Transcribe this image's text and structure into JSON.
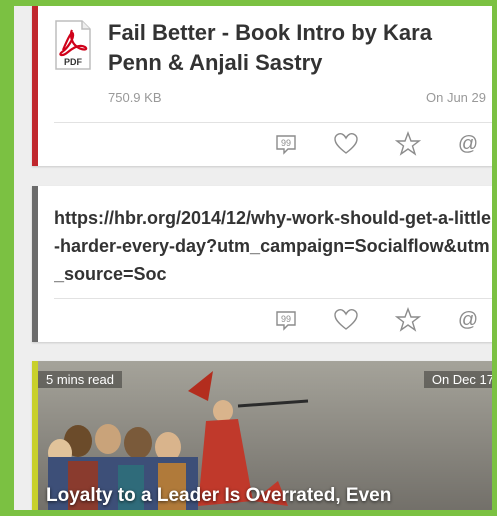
{
  "colors": {
    "frame": "#7bc142",
    "bar_pdf": "#c0272d",
    "bar_link": "#6b6b6b",
    "bar_article": "#c8d02b",
    "icon": "#8c8c8c"
  },
  "items": [
    {
      "type": "pdf",
      "icon": "pdf-icon",
      "icon_label": "PDF",
      "title": "Fail Better - Book Intro by Kara Penn & Anjali Sastry",
      "size": "750.9 KB",
      "date": "On Jun 29"
    },
    {
      "type": "link",
      "url": "https://hbr.org/2014/12/why-work-should-get-a-little-harder-every-day?utm_campaign=Socialflow&utm_source=Soc"
    },
    {
      "type": "article",
      "read_time": "5 mins read",
      "date": "On Dec 17",
      "title": "Loyalty to a Leader Is Overrated, Even"
    }
  ],
  "actions": [
    "comment-icon",
    "like-heart-icon",
    "favorite-star-icon",
    "mention-at-icon"
  ]
}
